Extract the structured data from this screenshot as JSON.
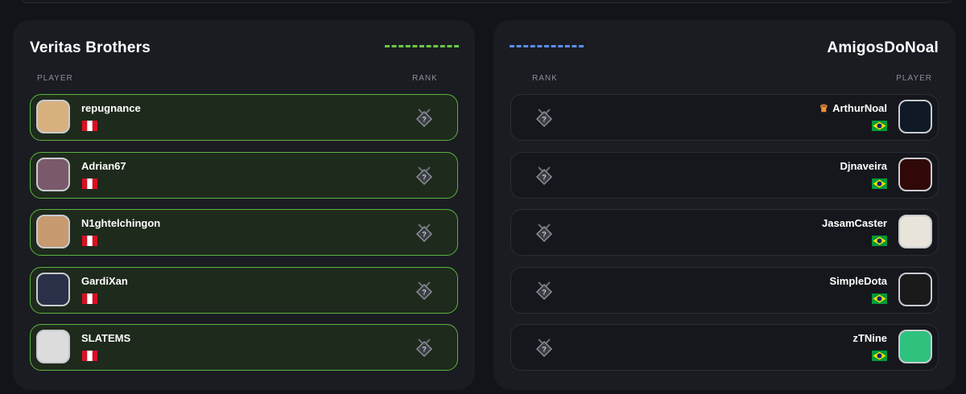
{
  "left_team": {
    "name": "Veritas Brothers",
    "accent": "#6cc644",
    "col_player": "PLAYER",
    "col_rank": "RANK",
    "players": [
      {
        "name": "repugnance",
        "flag": "peru-flag",
        "avatar_color": "#d8b080"
      },
      {
        "name": "Adrian67",
        "flag": "peru-flag",
        "avatar_color": "#7a5a6a"
      },
      {
        "name": "N1ghtelchingon",
        "flag": "peru-flag",
        "avatar_color": "#c89a70"
      },
      {
        "name": "GardiXan",
        "flag": "peru-flag",
        "avatar_color": "#2a3048"
      },
      {
        "name": "SLATEMS",
        "flag": "peru-flag",
        "avatar_color": "#dcdcdc"
      }
    ]
  },
  "right_team": {
    "name": "AmigosDoNoal",
    "accent": "#5a8ef0",
    "col_player": "PLAYER",
    "col_rank": "RANK",
    "players": [
      {
        "name": "ArthurNoal",
        "captain": true,
        "flag": "brazil-flag",
        "avatar_color": "#0f1a26"
      },
      {
        "name": "Djnaveira",
        "flag": "brazil-flag",
        "avatar_color": "#300808"
      },
      {
        "name": "JasamCaster",
        "flag": "brazil-flag",
        "avatar_color": "#e8e4da"
      },
      {
        "name": "SimpleDota",
        "flag": "brazil-flag",
        "avatar_color": "#1a1a1a"
      },
      {
        "name": "zTNine",
        "flag": "brazil-flag",
        "avatar_color": "#2ec27e"
      }
    ]
  }
}
